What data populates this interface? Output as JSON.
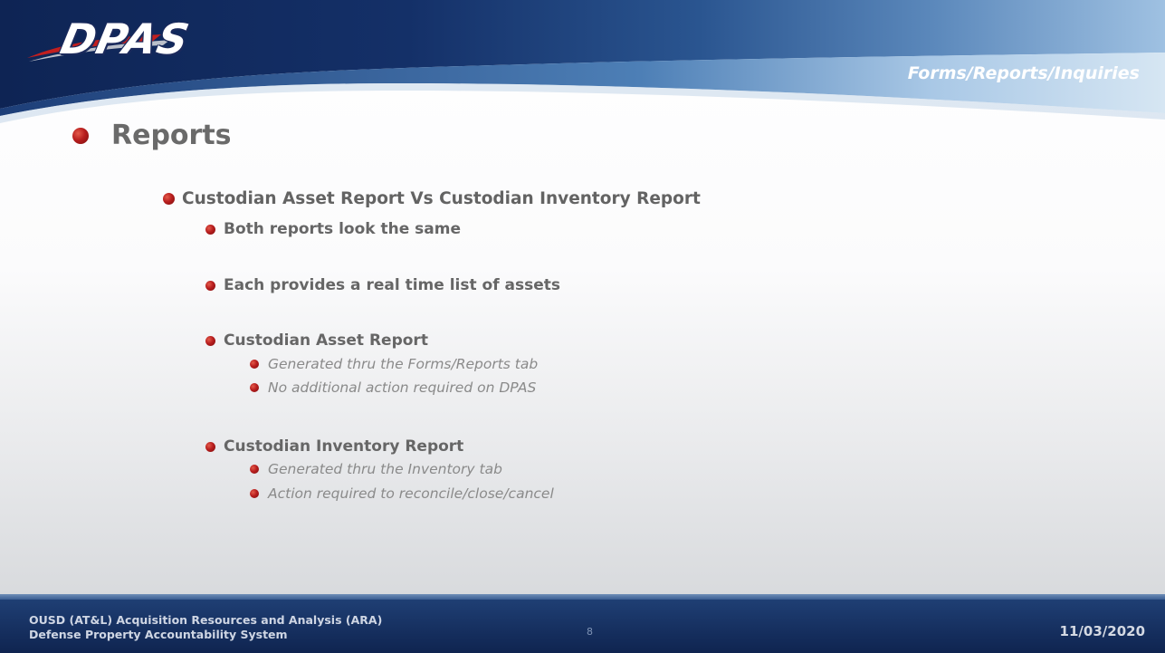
{
  "header": {
    "logo_text": "DPAS",
    "section_title": "Forms/Reports/Inquiries"
  },
  "slide": {
    "title": "Reports",
    "bullets": [
      {
        "text": "Custodian Asset Report  Vs  Custodian Inventory Report"
      },
      {
        "text": "Both reports look the same"
      },
      {
        "text": "Each provides a real time list of assets"
      },
      {
        "text": "Custodian Asset Report"
      },
      {
        "text": "Generated thru the Forms/Reports tab"
      },
      {
        "text": "No additional action required on DPAS"
      },
      {
        "text": "Custodian Inventory Report"
      },
      {
        "text": "Generated thru the Inventory tab"
      },
      {
        "text": "Action required to reconcile/close/cancel"
      }
    ]
  },
  "footer": {
    "org_line1": "OUSD (AT&L) Acquisition Resources and Analysis (ARA)",
    "org_line2": "Defense Property Accountability System",
    "page_number": "8",
    "date": "11/03/2020"
  },
  "colors": {
    "header_dark": "#142a5c",
    "header_light": "#b9d3ec",
    "bullet_red": "#b81e1e",
    "footer_blue": "#17336a"
  }
}
